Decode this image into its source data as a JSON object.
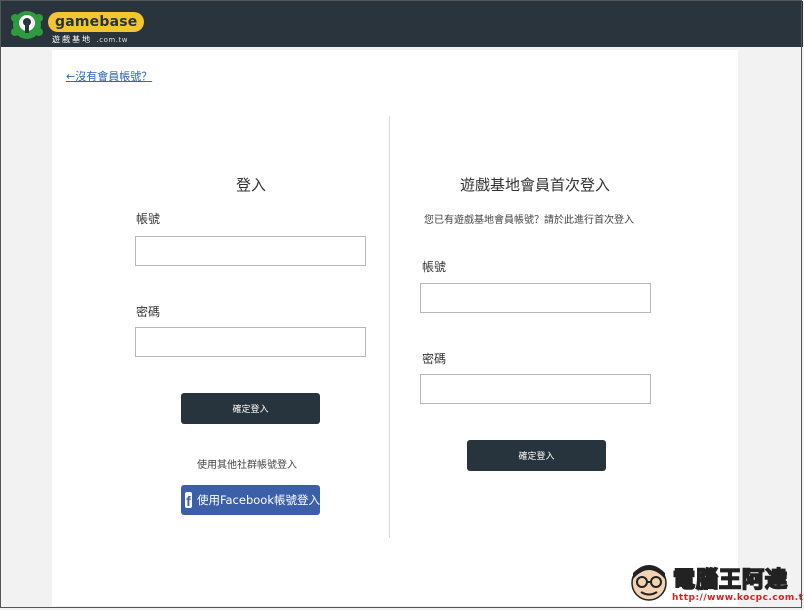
{
  "brand": {
    "name": "gamebase",
    "subtitle": "遊戲基地",
    "domain_suffix": ".com.tw",
    "logo_accent": "#f2c531",
    "logo_green": "#2e9b3e"
  },
  "colors": {
    "topbar": "#2a343c",
    "button": "#27343d",
    "facebook": "#3b5fa8",
    "link": "#2f67b6"
  },
  "back_link": "←沒有會員帳號？",
  "login": {
    "title": "登入",
    "account_label": "帳號",
    "account_value": "",
    "password_label": "密碼",
    "password_value": "",
    "submit_label": "確定登入",
    "social_hint": "使用其他社群帳號登入",
    "facebook_label": "使用Facebook帳號登入"
  },
  "first_login": {
    "title": "遊戲基地會員首次登入",
    "description": "您已有遊戲基地會員帳號？請於此進行首次登入",
    "account_label": "帳號",
    "account_value": "",
    "password_label": "密碼",
    "password_value": "",
    "submit_label": "確定登入"
  },
  "watermark": {
    "title": "電腦王阿達",
    "url": "http://www.kocpc.com.tw"
  }
}
